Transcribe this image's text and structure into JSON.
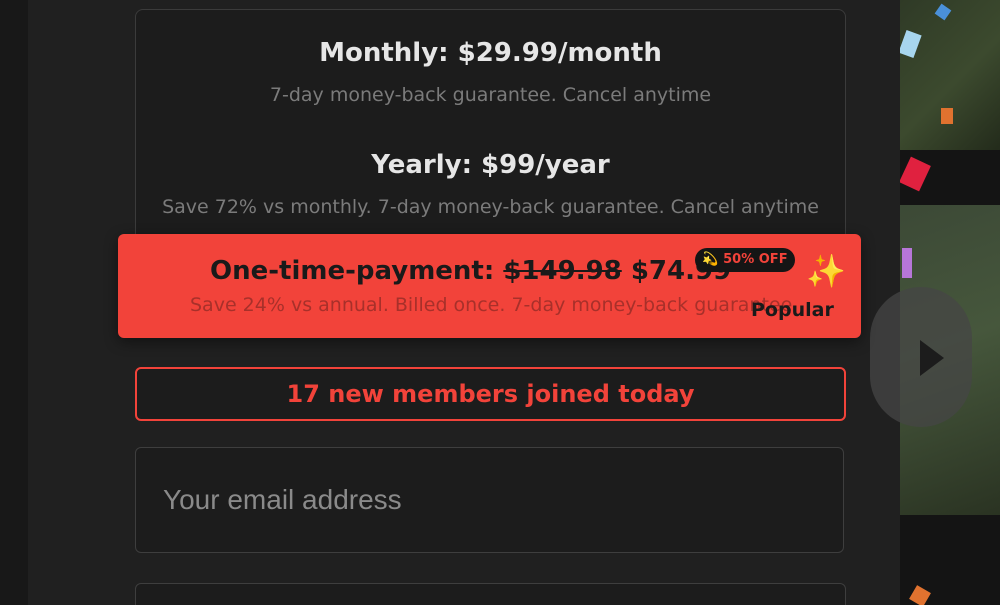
{
  "plans": {
    "monthly": {
      "title": "Monthly: $29.99/month",
      "subtitle": "7-day money-back guarantee. Cancel anytime"
    },
    "yearly": {
      "title": "Yearly: $99/year",
      "subtitle": "Save 72% vs monthly. 7-day money-back guarantee. Cancel anytime"
    },
    "one_time": {
      "title_prefix": "One-time-payment:",
      "old_price": "$149.98",
      "new_price": "$74.99",
      "subtitle": "Save 24% vs annual. Billed once. 7-day money-back guarantee",
      "badge": "💫 50% OFF",
      "sparkle": "✨",
      "popular_label": "Popular"
    }
  },
  "social_proof": {
    "text": "17 new members joined today"
  },
  "email": {
    "placeholder": "Your email address",
    "value": ""
  },
  "colors": {
    "accent": "#f2433a",
    "background": "#1f1f1f",
    "panel": "#1c1c1c"
  }
}
